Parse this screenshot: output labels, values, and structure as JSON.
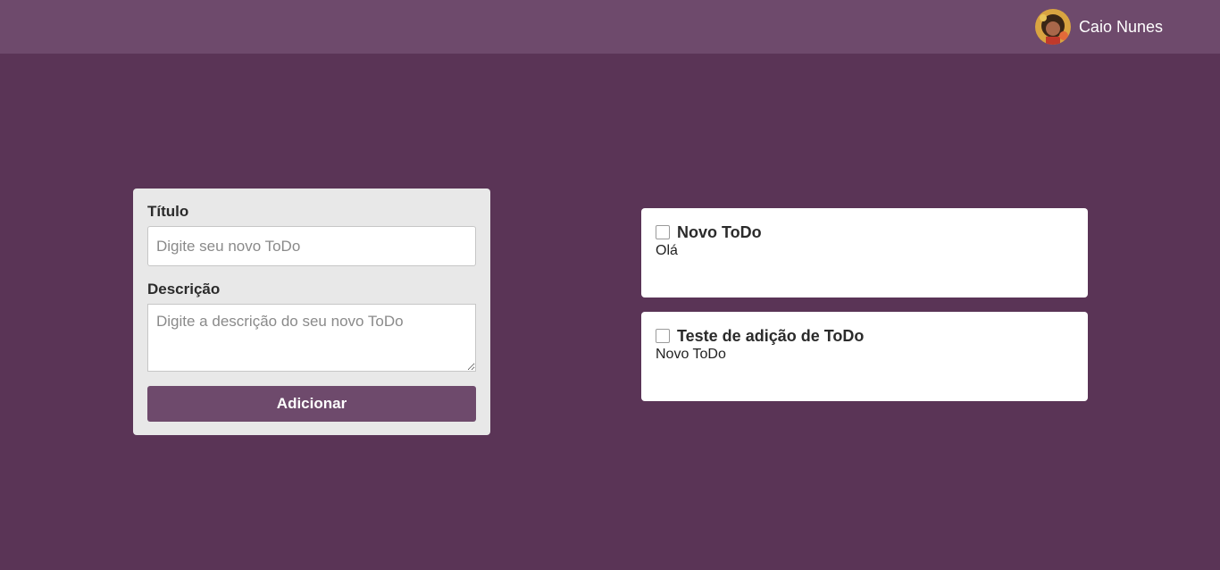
{
  "header": {
    "user_name": "Caio Nunes",
    "avatar": "user-avatar-photo"
  },
  "form": {
    "title_label": "Título",
    "title_placeholder": "Digite seu novo ToDo",
    "title_value": "",
    "description_label": "Descrição",
    "description_placeholder": "Digite a descrição do seu novo ToDo",
    "description_value": "",
    "submit_label": "Adicionar"
  },
  "todos": [
    {
      "title": "Novo ToDo",
      "description": "Olá",
      "checked": false
    },
    {
      "title": "Teste de adição de ToDo",
      "description": "Novo ToDo",
      "checked": false
    }
  ],
  "colors": {
    "background": "#5a3456",
    "header": "#6e4a6c",
    "form_card": "#e8e8e8",
    "button": "#6e4a6c",
    "todo_card": "#ffffff"
  }
}
